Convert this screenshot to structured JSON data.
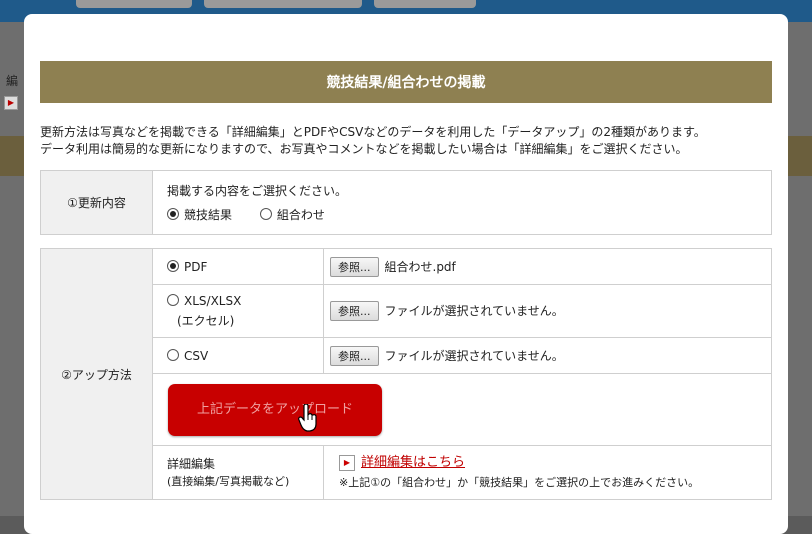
{
  "background": {
    "partial_text": "編"
  },
  "modal": {
    "title": "競技結果/組合わせの掲載",
    "intro_line1": "更新方法は写真などを掲載できる「詳細編集」とPDFやCSVなどのデータを利用した「データアップ」の2種類があります。",
    "intro_line2": "データ利用は簡易的な更新になりますので、お写真やコメントなどを掲載したい場合は「詳細編集」をご選択ください。"
  },
  "section1": {
    "label": "①更新内容",
    "prompt": "掲載する内容をご選択ください。",
    "options": [
      {
        "label": "競技結果",
        "selected": true
      },
      {
        "label": "組合わせ",
        "selected": false
      }
    ]
  },
  "section2": {
    "label": "②アップ方法",
    "rows": [
      {
        "label": "PDF",
        "sub": "",
        "selected": true,
        "browse": "参照...",
        "file": "組合わせ.pdf"
      },
      {
        "label": "XLS/XLSX",
        "sub": "(エクセル)",
        "selected": false,
        "browse": "参照...",
        "file": "ファイルが選択されていません。"
      },
      {
        "label": "CSV",
        "sub": "",
        "selected": false,
        "browse": "参照...",
        "file": "ファイルが選択されていません。"
      }
    ],
    "upload_button": "上記データをアップロード",
    "detail_label": "詳細編集",
    "detail_sub": "(直接編集/写真掲載など)",
    "detail_link": "詳細編集はこちら",
    "detail_note": "※上記①の「組合わせ」か「競技結果」をご選択の上でお進みください。"
  },
  "colors": {
    "title_bar": "#8e8051",
    "upload_button": "#c80000",
    "link": "#c00000"
  }
}
